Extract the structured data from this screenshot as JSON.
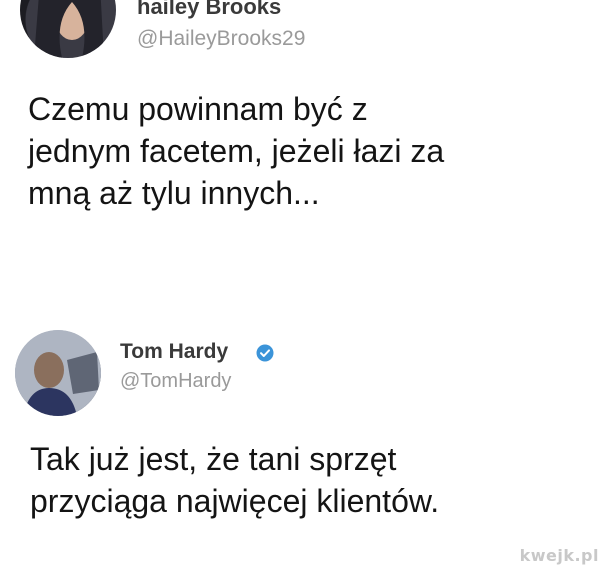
{
  "tweets": [
    {
      "author_name": "hailey Brooks",
      "handle": "@HaileyBrooks29",
      "verified": false,
      "lines": [
        "Czemu powinnam być z",
        "jednym facetem, jeżeli łazi za",
        "mną aż tylu innych..."
      ]
    },
    {
      "author_name": "Tom Hardy",
      "handle": "@TomHardy",
      "verified": true,
      "lines": [
        "Tak już jest, że tani sprzęt",
        "przyciąga najwięcej klientów."
      ]
    }
  ],
  "watermark": "kwejk.pl",
  "colors": {
    "verified_badge": "#3b94d9",
    "name": "#3a3a3a",
    "handle": "#9a9a9a",
    "text": "#141414"
  },
  "icons": {
    "verified": "verified-badge-icon"
  }
}
